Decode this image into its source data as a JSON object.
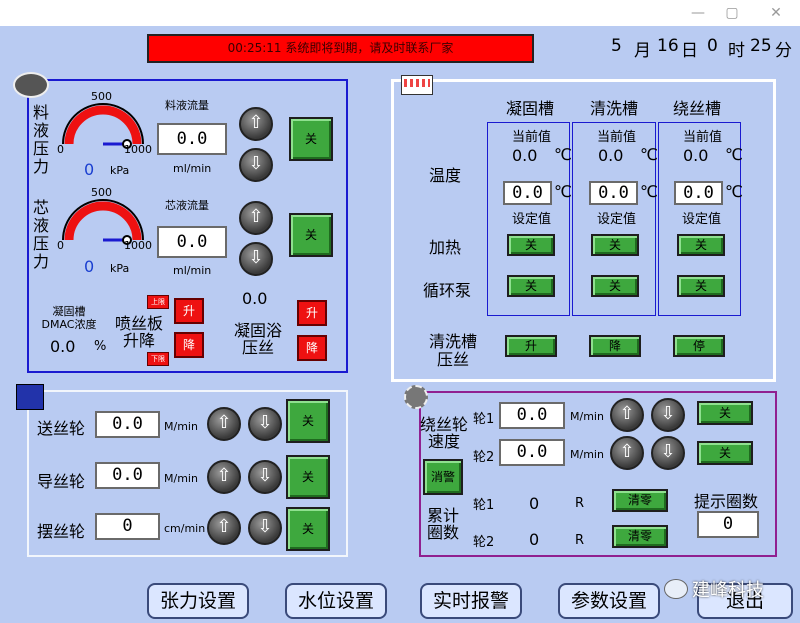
{
  "window": {
    "min_icon": "—",
    "max_icon": "▢",
    "close_icon": "✕"
  },
  "alarm_message": "00:25:11  系统即将到期，请及时联系厂家",
  "datetime": {
    "month": "5",
    "month_unit": "月",
    "day": "16",
    "day_unit": "日",
    "hour": "0",
    "hour_unit": "时",
    "minute": "25",
    "minute_unit": "分"
  },
  "pressure_panel": {
    "feed": {
      "label": "料液压力",
      "gauge_max_label": "500",
      "gauge_min": "0",
      "gauge_max": "1000",
      "value": "0",
      "unit": "kPa",
      "flow_label": "料液流量",
      "flow_value": "0.0",
      "flow_unit": "ml/min",
      "toggle": "关",
      "gauge_fraction": 0
    },
    "core": {
      "label": "芯液压力",
      "gauge_max_label": "500",
      "gauge_min": "0",
      "gauge_max": "1000",
      "value": "0",
      "unit": "kPa",
      "flow_label": "芯液流量",
      "flow_value": "0.0",
      "flow_unit": "ml/min",
      "toggle": "关",
      "gauge_fraction": 0
    },
    "dmac_label": "凝固槽\nDMAC浓度",
    "dmac_value": "0.0",
    "dmac_unit": "%",
    "spinneret": {
      "label": "喷丝板\n升降",
      "up_limit": "上限",
      "down_limit": "下限",
      "up": "升",
      "down": "降"
    },
    "bath": {
      "value": "0.0",
      "label": "凝固浴\n压丝",
      "up": "升",
      "down": "降"
    }
  },
  "tank_panel": {
    "columns": [
      "凝固槽",
      "清洗槽",
      "绕丝槽"
    ],
    "current_label": "当前值",
    "set_label": "设定值",
    "current_values": [
      "0.0",
      "0.0",
      "0.0"
    ],
    "set_values": [
      "0.0",
      "0.0",
      "0.0"
    ],
    "temp_unit": "℃",
    "row_temp": "温度",
    "row_heat": "加热",
    "row_pump": "循环泵",
    "heat": [
      "关",
      "关",
      "关"
    ],
    "pump": [
      "关",
      "关",
      "关"
    ],
    "wash_label": "清洗槽\n压丝",
    "wash_buttons": [
      "升",
      "降",
      "停"
    ]
  },
  "wheel_panel": {
    "rows": [
      {
        "label": "送丝轮",
        "value": "0.0",
        "unit": "M/min",
        "toggle": "关"
      },
      {
        "label": "导丝轮",
        "value": "0.0",
        "unit": "M/min",
        "toggle": "关"
      },
      {
        "label": "摆丝轮",
        "value": "0",
        "unit": "cm/min",
        "toggle": "关"
      }
    ]
  },
  "winding_panel": {
    "speed_label": "绕丝轮\n速度",
    "wheel1": "轮1",
    "wheel2": "轮2",
    "speed1": "0.0",
    "speed2": "0.0",
    "unit": "M/min",
    "toggle1": "关",
    "toggle2": "关",
    "silence": "消警",
    "count_label": "累计\n圈数",
    "count1": "0",
    "count2": "0",
    "count_unit": "R",
    "clear": "清零",
    "prompt_label": "提示圈数",
    "prompt_value": "0"
  },
  "nav": [
    "张力设置",
    "水位设置",
    "实时报警",
    "参数设置",
    "退出"
  ],
  "watermark": "建峰科技",
  "colors": {
    "background": "#b9cbf2",
    "alarm": "#ff0000",
    "green": "#3ea83e",
    "red": "#ee1111",
    "blue_border": "#1a1ad0"
  }
}
